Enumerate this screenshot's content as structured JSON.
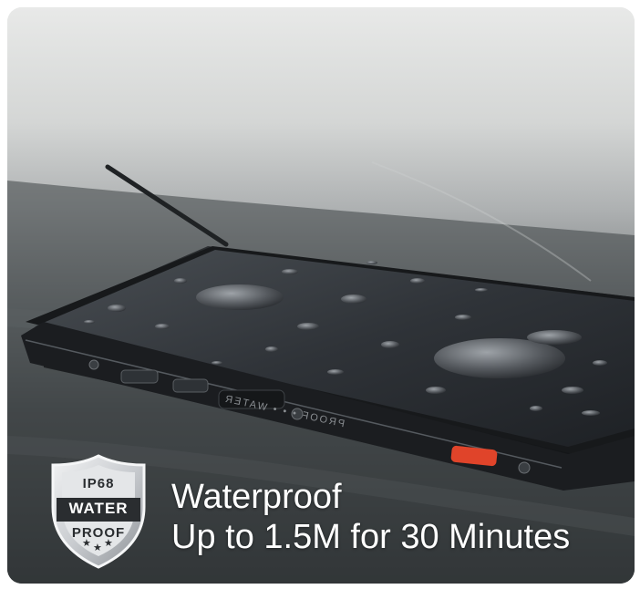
{
  "badge": {
    "rating": "IP68",
    "line1": "WATER",
    "line2": "PROOF"
  },
  "headline": {
    "title": "Waterproof",
    "subtitle": "Up to 1.5M for 30 Minutes"
  },
  "phone_side_label": "PROOF • • • WATER",
  "colors": {
    "text": "#ffffff",
    "badge_silver": "#d6d8da",
    "badge_dark": "#2a2d30",
    "accent_button": "#e0442a"
  }
}
